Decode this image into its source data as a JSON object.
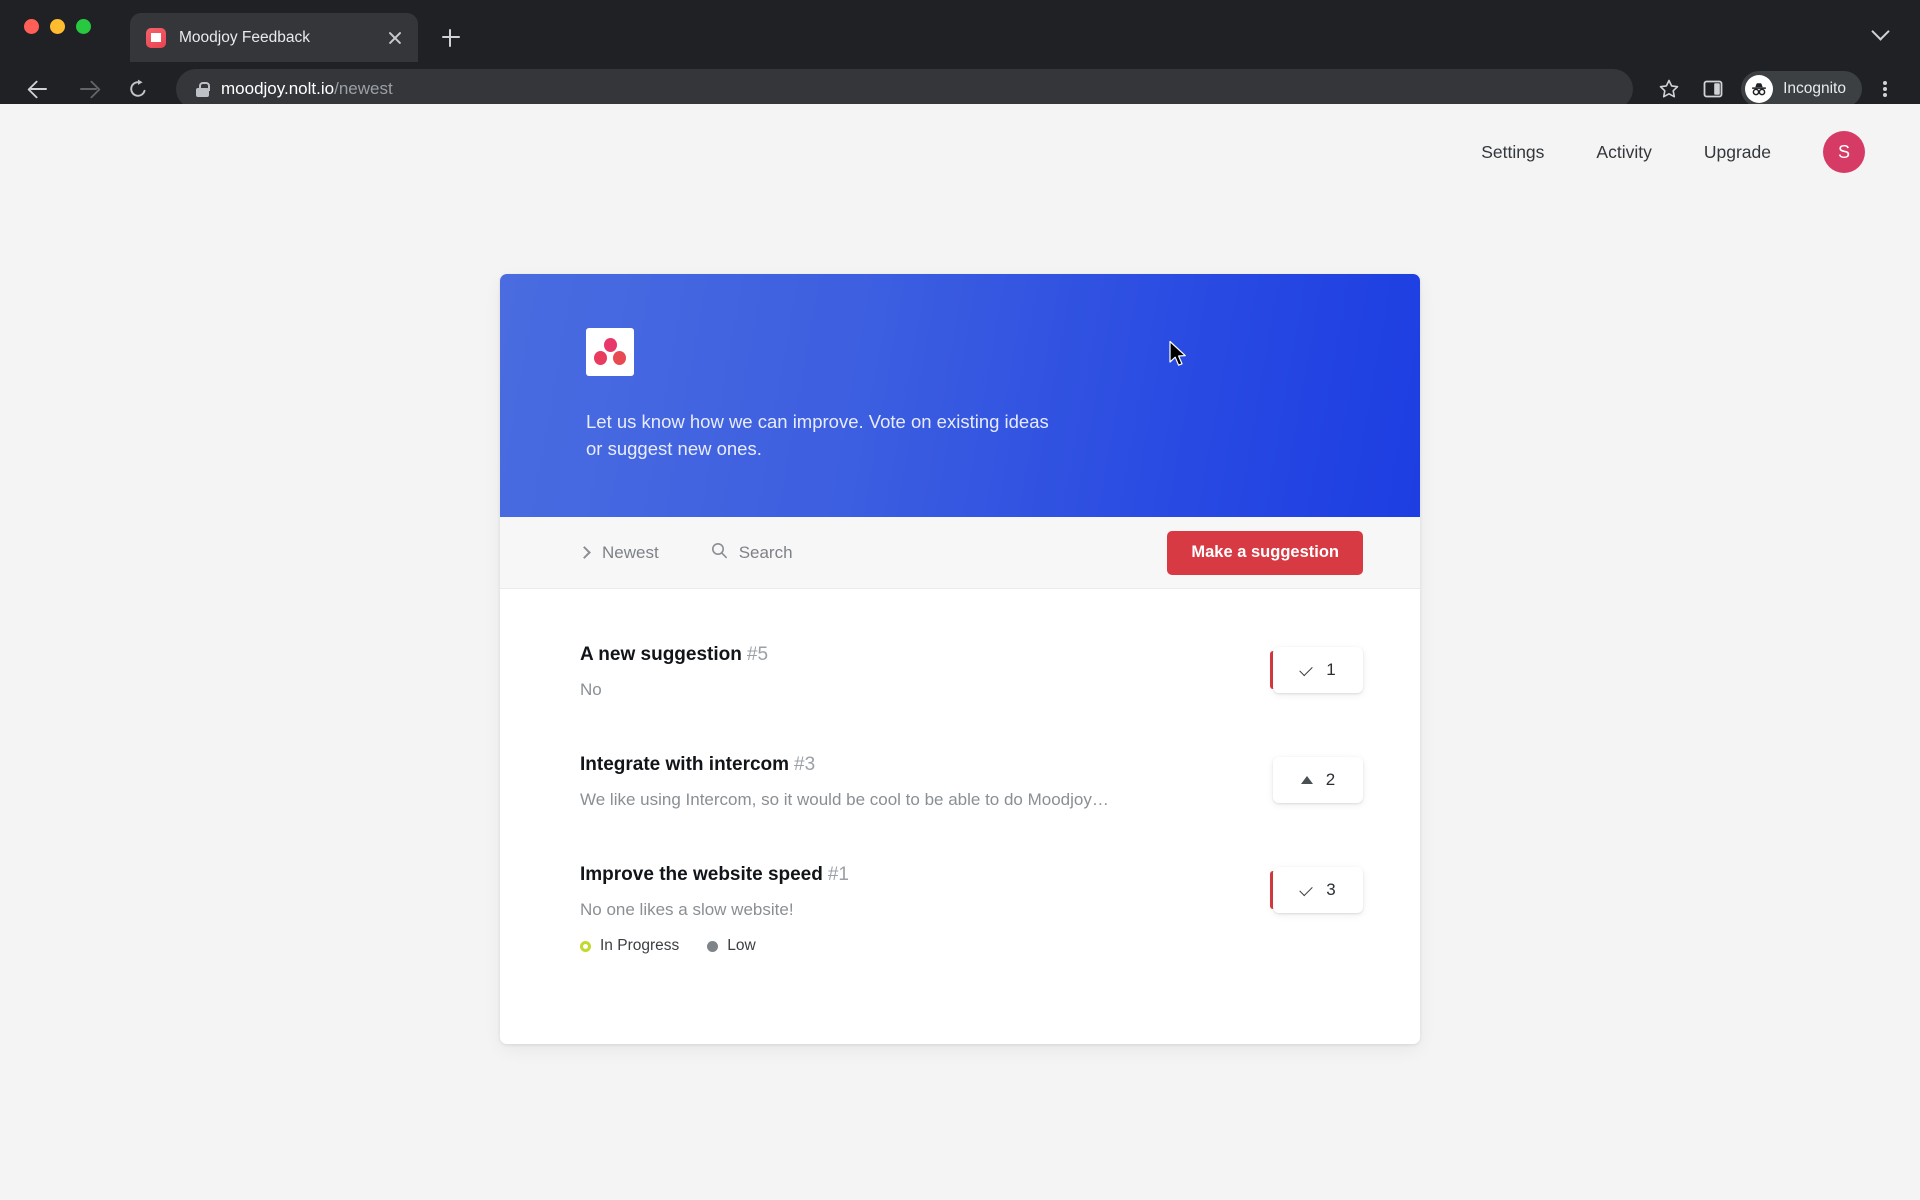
{
  "browser": {
    "tab_title": "Moodjoy Feedback",
    "favicon_icon": "moodjoy-favicon",
    "close_icon": "close-icon",
    "new_tab_icon": "plus-icon",
    "tab_list_icon": "chevron-down-icon",
    "back_icon": "arrow-left-icon",
    "forward_icon": "arrow-right-icon",
    "reload_icon": "reload-icon",
    "lock_icon": "lock-icon",
    "url_domain": "moodjoy.nolt.io",
    "url_path": "/newest",
    "bookmark_icon": "star-icon",
    "side_panel_icon": "side-panel-icon",
    "profile_label": "Incognito",
    "profile_icon": "incognito-icon",
    "menu_icon": "kebab-menu-icon"
  },
  "topnav": {
    "links": [
      {
        "label": "Settings"
      },
      {
        "label": "Activity"
      },
      {
        "label": "Upgrade"
      }
    ],
    "avatar_initial": "S",
    "avatar_color": "#d63b65"
  },
  "banner": {
    "logo_icon": "moodjoy-logo",
    "description": "Let us know how we can improve. Vote on existing ideas or suggest new ones.",
    "gradient_from": "#4a6ce0",
    "gradient_to": "#1d3ee2"
  },
  "toolbar": {
    "sort_label": "Newest",
    "sort_icon": "chevron-right-icon",
    "search_label": "Search",
    "search_icon": "search-icon",
    "suggest_label": "Make a suggestion",
    "suggest_color": "#d73a42"
  },
  "suggestions": [
    {
      "title": "A new suggestion",
      "number": "#5",
      "description": "No",
      "votes": "1",
      "voted": true,
      "vote_icon": "check-icon",
      "badges": []
    },
    {
      "title": "Integrate with intercom",
      "number": "#3",
      "description": "We like using Intercom, so it would be cool to be able to do Moodjoy…",
      "votes": "2",
      "voted": false,
      "vote_icon": "triangle-up-icon",
      "badges": []
    },
    {
      "title": "Improve the website speed",
      "number": "#1",
      "description": "No one likes a slow website!",
      "votes": "3",
      "voted": true,
      "vote_icon": "check-icon",
      "badges": [
        {
          "label": "In Progress",
          "style": "ring",
          "color": "#c3d92b"
        },
        {
          "label": "Low",
          "style": "solid",
          "color": "#7e8488"
        }
      ]
    }
  ]
}
